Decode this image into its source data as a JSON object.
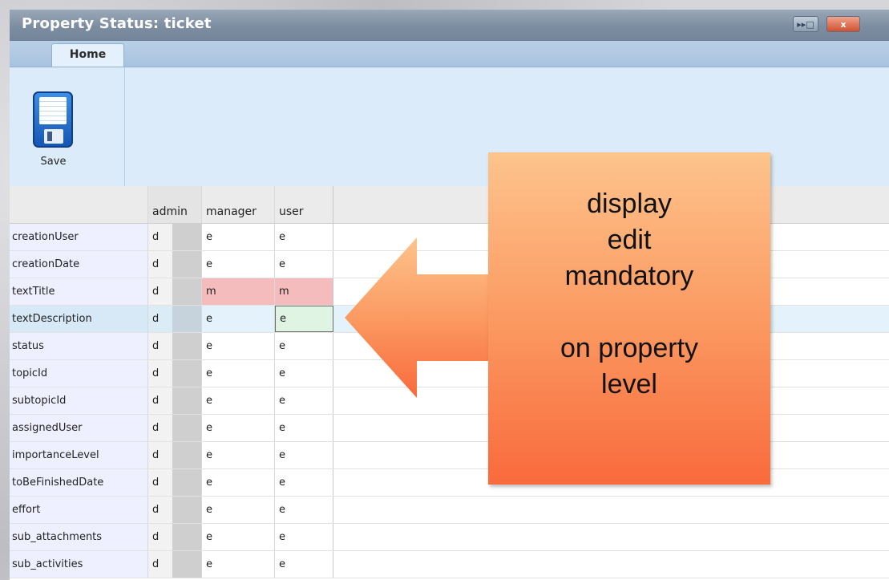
{
  "window": {
    "title": "Property Status: ticket"
  },
  "titlebar_buttons": {
    "restore_icon": "restore-icon",
    "close_label": "x"
  },
  "tabs": [
    {
      "label": "Home",
      "active": true
    }
  ],
  "toolbar": {
    "save_label": "Save",
    "save_icon": "floppy-disk-icon"
  },
  "grid": {
    "columns": [
      "admin",
      "manager",
      "user"
    ],
    "rows": [
      {
        "property": "creationUser",
        "admin": "d",
        "manager": "e",
        "user": "e"
      },
      {
        "property": "creationDate",
        "admin": "d",
        "manager": "e",
        "user": "e"
      },
      {
        "property": "textTitle",
        "admin": "d",
        "manager": "m",
        "user": "m"
      },
      {
        "property": "textDescription",
        "admin": "d",
        "manager": "e",
        "user": "e"
      },
      {
        "property": "status",
        "admin": "d",
        "manager": "e",
        "user": "e"
      },
      {
        "property": "topicId",
        "admin": "d",
        "manager": "e",
        "user": "e"
      },
      {
        "property": "subtopicId",
        "admin": "d",
        "manager": "e",
        "user": "e"
      },
      {
        "property": "assignedUser",
        "admin": "d",
        "manager": "e",
        "user": "e"
      },
      {
        "property": "importanceLevel",
        "admin": "d",
        "manager": "e",
        "user": "e"
      },
      {
        "property": "toBeFinishedDate",
        "admin": "d",
        "manager": "e",
        "user": "e"
      },
      {
        "property": "effort",
        "admin": "d",
        "manager": "e",
        "user": "e"
      },
      {
        "property": "sub_attachments",
        "admin": "d",
        "manager": "e",
        "user": "e"
      },
      {
        "property": "sub_activities",
        "admin": "d",
        "manager": "e",
        "user": "e"
      }
    ]
  },
  "callout": {
    "lines": [
      "display",
      "edit",
      "mandatory",
      "",
      "on property",
      "level"
    ],
    "color_top": "#fcc48c",
    "color_bottom": "#f96a3c"
  },
  "colors": {
    "mandatory_highlight": "#f4bcbc",
    "selected_row": "#e3f2fb",
    "titlebar": "#7d8da1"
  }
}
